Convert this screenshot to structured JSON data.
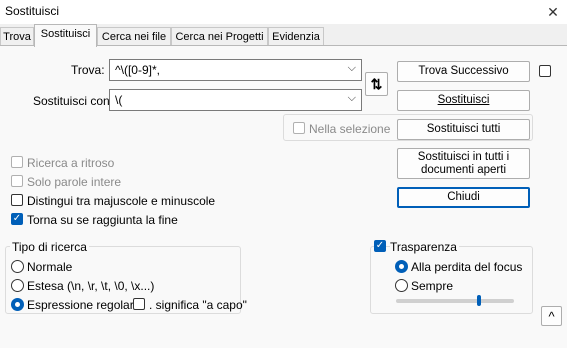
{
  "window": {
    "title": "Sostituisci",
    "close_icon": "✕"
  },
  "tabs": [
    {
      "label": "Trova"
    },
    {
      "label": "Sostituisci"
    },
    {
      "label": "Cerca nei file"
    },
    {
      "label": "Cerca nei Progetti"
    },
    {
      "label": "Evidenzia"
    }
  ],
  "find": {
    "label": "Trova:",
    "value": "^\\([0-9]*,"
  },
  "replace": {
    "label": "Sostituisci con:",
    "value": "\\("
  },
  "swap_icon": "⇅",
  "in_selection": "Nella selezione",
  "buttons": {
    "find_next": "Trova Successivo",
    "replace": "Sostituisci",
    "replace_all": "Sostituisci tutti",
    "replace_all_open_1": "Sostituisci in tutti i",
    "replace_all_open_2": "documenti aperti",
    "close": "Chiudi"
  },
  "options": {
    "backward": "Ricerca a ritroso",
    "whole_word": "Solo parole intere",
    "match_case": "Distingui tra majuscole e minuscole",
    "wrap": "Torna su se raggiunta la fine"
  },
  "search_mode": {
    "title": "Tipo di ricerca",
    "normal": "Normale",
    "extended": "Estesa (\\n, \\r, \\t, \\0, \\x...)",
    "regex": "Espressione regolare",
    "dot_newline": ". significa \"a capo\""
  },
  "transparency": {
    "title": "Trasparenza",
    "on_lose_focus": "Alla perdita del focus",
    "always": "Sempre",
    "level": 0.7
  },
  "collapse_icon": "^"
}
